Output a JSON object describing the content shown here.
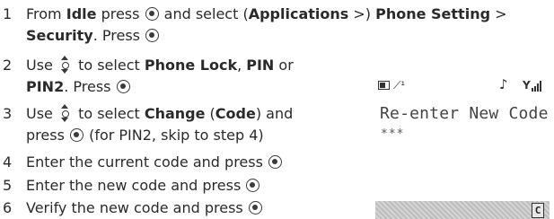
{
  "steps": [
    {
      "number": "1",
      "line1": {
        "a": "From ",
        "b1": "Idle",
        "c": " press ",
        "d": " and select (",
        "b2": "Applications",
        "e": " >) ",
        "b3": "Phone Setting",
        "f": " >"
      },
      "line2": {
        "b1": "Security",
        "a": ". Press "
      }
    },
    {
      "number": "2",
      "line1": {
        "a": "Use ",
        "b": " to select ",
        "b1": "Phone Lock",
        "c": ", ",
        "b2": "PIN",
        "d": " or"
      },
      "line2": {
        "b1": "PIN2",
        "a": ". Press "
      }
    },
    {
      "number": "3",
      "line1": {
        "a": "Use ",
        "b": " to select ",
        "b1": "Change",
        "c": " (",
        "b2": "Code",
        "d": ") and"
      },
      "line2": {
        "a": "press ",
        "b": " (for PIN2, skip to step 4)"
      }
    },
    {
      "number": "4",
      "text": "Enter the current code and press "
    },
    {
      "number": "5",
      "text": "Enter the new code and press "
    },
    {
      "number": "6",
      "text": "Verify the new code and press "
    }
  ],
  "phone_screen": {
    "prompt": "Re-enter New Code",
    "masked_input": "***",
    "soft_key": "C"
  },
  "icons": [
    "ok-key-icon",
    "nav-key-icon",
    "battery-icon",
    "network-icon",
    "music-note-icon",
    "signal-strength-icon",
    "clear-key-icon"
  ]
}
